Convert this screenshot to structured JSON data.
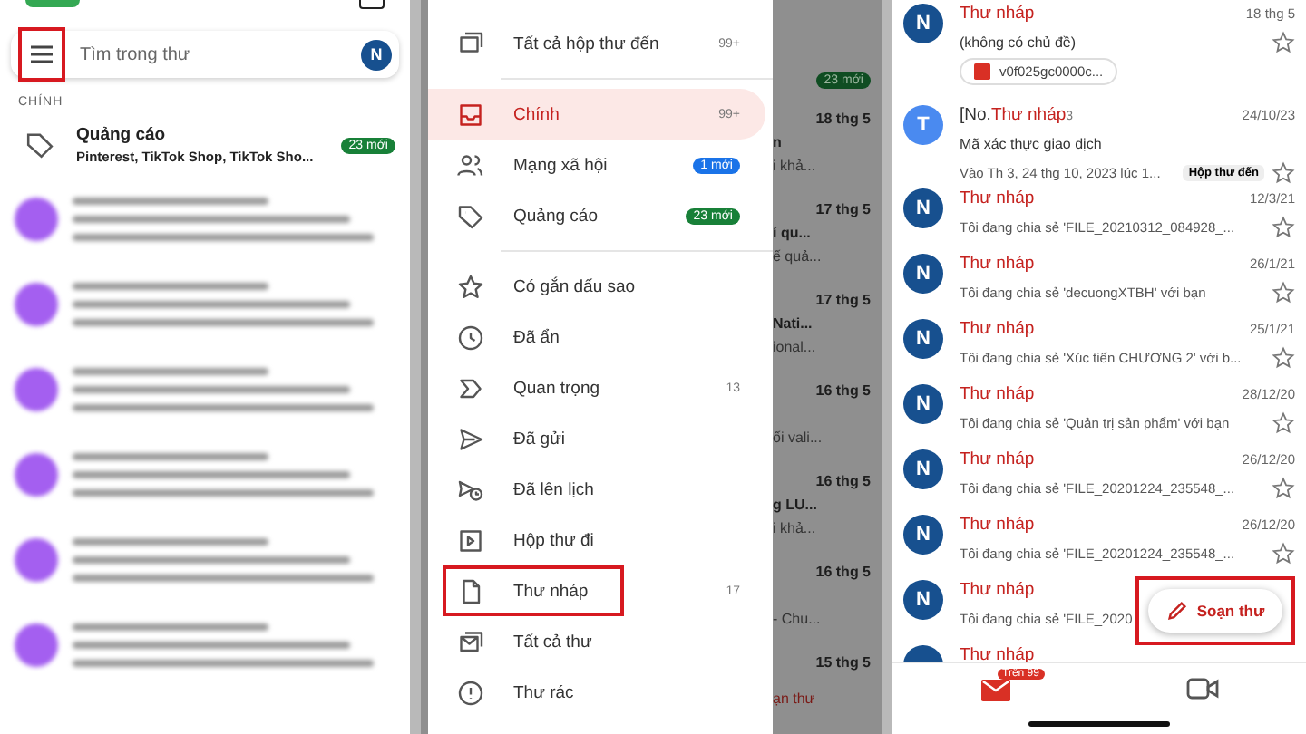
{
  "inbox_screen": {
    "search": {
      "placeholder": "Tìm trong thư",
      "avatar": "N",
      "menu_annotated": true
    },
    "section_label": "CHÍNH",
    "category_row": {
      "title": "Quảng cáo",
      "senders": "Pinterest, TikTok Shop, TikTok Sho...",
      "badge": "23 mới"
    }
  },
  "drawer": {
    "groups": [
      {
        "items": [
          {
            "label": "Tất cả hộp thư đến",
            "count": "99+",
            "selected": false,
            "annotated": false
          }
        ]
      },
      {
        "items": [
          {
            "label": "Chính",
            "count": "99+",
            "selected": true,
            "annotated": false
          },
          {
            "label": "Mạng xã hội",
            "badge": "1 mới",
            "color": "#1a73e8",
            "selected": false,
            "annotated": false
          },
          {
            "label": "Quảng cáo",
            "badge": "23 mới",
            "color": "#188038",
            "selected": false,
            "annotated": false
          }
        ]
      },
      {
        "items": [
          {
            "label": "Có gắn dấu sao",
            "selected": false,
            "annotated": false
          },
          {
            "label": "Đã ẩn",
            "selected": false,
            "annotated": false
          },
          {
            "label": "Quan trọng",
            "count": "13",
            "selected": false,
            "annotated": false
          },
          {
            "label": "Đã gửi",
            "selected": false,
            "annotated": false
          },
          {
            "label": "Đã lên lịch",
            "selected": false,
            "annotated": false
          },
          {
            "label": "Hộp thư đi",
            "selected": false,
            "annotated": false
          },
          {
            "label": "Thư nháp",
            "count": "17",
            "selected": false,
            "annotated": true
          },
          {
            "label": "Tất cả thư",
            "selected": false,
            "annotated": false
          },
          {
            "label": "Thư rác",
            "selected": false,
            "annotated": false
          }
        ]
      }
    ]
  },
  "background_list": {
    "badge": "23 mới",
    "rows": [
      {
        "date": "18 thg 5",
        "subject": "n",
        "snippet": "i khả..."
      },
      {
        "date": "17 thg 5",
        "subject": "í qu...",
        "snippet": "ế quả..."
      },
      {
        "date": "17 thg 5",
        "subject": "Nati...",
        "snippet": "ional..."
      },
      {
        "date": "16 thg 5",
        "snippet": "ối vali..."
      },
      {
        "date": "16 thg 5",
        "subject": "g LU...",
        "snippet": "i khả..."
      },
      {
        "date": "16 thg 5",
        "snippet": "- Chu..."
      },
      {
        "date": "15 thg 5"
      }
    ],
    "compose_fragment": "ạn thư"
  },
  "drafts_screen": {
    "emails": [
      {
        "avatar": "N",
        "color": "#17508f",
        "sender": "Thư nháp",
        "date": "18 thg 5",
        "subject": "(không có chủ đề)",
        "attachment": "v0f025gc0000c...",
        "starred": false
      },
      {
        "avatar": "T",
        "color": "#4a8af0",
        "sender_prefix": "[No.",
        "sender": "Thư nháp",
        "thread_count": "3",
        "date": "24/10/23",
        "subject": "Mã xác thực giao dịch",
        "snippet": "Vào Th 3, 24 thg 10, 2023 lúc 1...",
        "label": "Hộp thư đến",
        "starred": false
      },
      {
        "avatar": "N",
        "color": "#17508f",
        "sender": "Thư nháp",
        "date": "12/3/21",
        "snippet": "Tôi đang chia sẻ 'FILE_20210312_084928_...",
        "starred": false
      },
      {
        "avatar": "N",
        "color": "#17508f",
        "sender": "Thư nháp",
        "date": "26/1/21",
        "snippet": "Tôi đang chia sẻ 'decuongXTBH' với bạn",
        "starred": false
      },
      {
        "avatar": "N",
        "color": "#17508f",
        "sender": "Thư nháp",
        "date": "25/1/21",
        "snippet": "Tôi đang chia sẻ 'Xúc tiến CHƯƠNG 2' với b...",
        "starred": false
      },
      {
        "avatar": "N",
        "color": "#17508f",
        "sender": "Thư nháp",
        "date": "28/12/20",
        "snippet": "Tôi đang chia sẻ 'Quản trị sản phẩm' với bạn",
        "starred": false
      },
      {
        "avatar": "N",
        "color": "#17508f",
        "sender": "Thư nháp",
        "date": "26/12/20",
        "snippet": "Tôi đang chia sẻ 'FILE_20201224_235548_...",
        "starred": false
      },
      {
        "avatar": "N",
        "color": "#17508f",
        "sender": "Thư nháp",
        "date": "26/12/20",
        "snippet": "Tôi đang chia sẻ 'FILE_20201224_235548_...",
        "starred": false
      },
      {
        "avatar": "N",
        "color": "#17508f",
        "sender": "Thư nháp",
        "snippet": "Tôi đang chia sẻ 'FILE_2020"
      },
      {
        "color": "#17508f",
        "sender": "Thư nháp"
      }
    ],
    "compose": {
      "label": "Soạn thư",
      "annotated": true
    },
    "nav_badge": "Trên 99"
  }
}
